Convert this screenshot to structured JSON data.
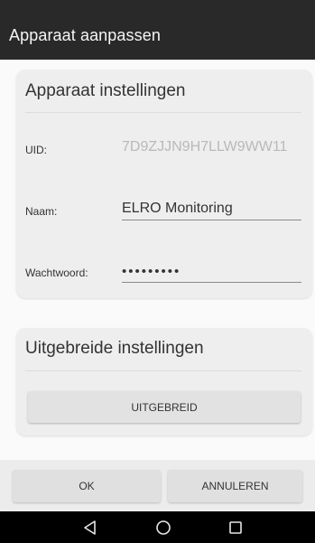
{
  "appbar": {
    "title": "Apparaat aanpassen"
  },
  "device_settings": {
    "title": "Apparaat instellingen",
    "uid": {
      "label": "UID:",
      "value": "7D9ZJJN9H7LLW9WW11"
    },
    "name": {
      "label": "Naam:",
      "value": "ELRO Monitoring"
    },
    "password": {
      "label": "Wachtwoord:",
      "value": "•••••••••"
    }
  },
  "extended_settings": {
    "title": "Uitgebreide instellingen",
    "button_label": "UITGEBREID"
  },
  "actions": {
    "ok_label": "OK",
    "cancel_label": "ANNULEREN"
  },
  "navbar": {
    "icons": [
      "back-icon",
      "home-icon",
      "recents-icon"
    ]
  },
  "colors": {
    "appbar": "#292929",
    "card": "#eeeeee",
    "readonly_text": "#b9b9b9",
    "navbar": "#000000"
  }
}
